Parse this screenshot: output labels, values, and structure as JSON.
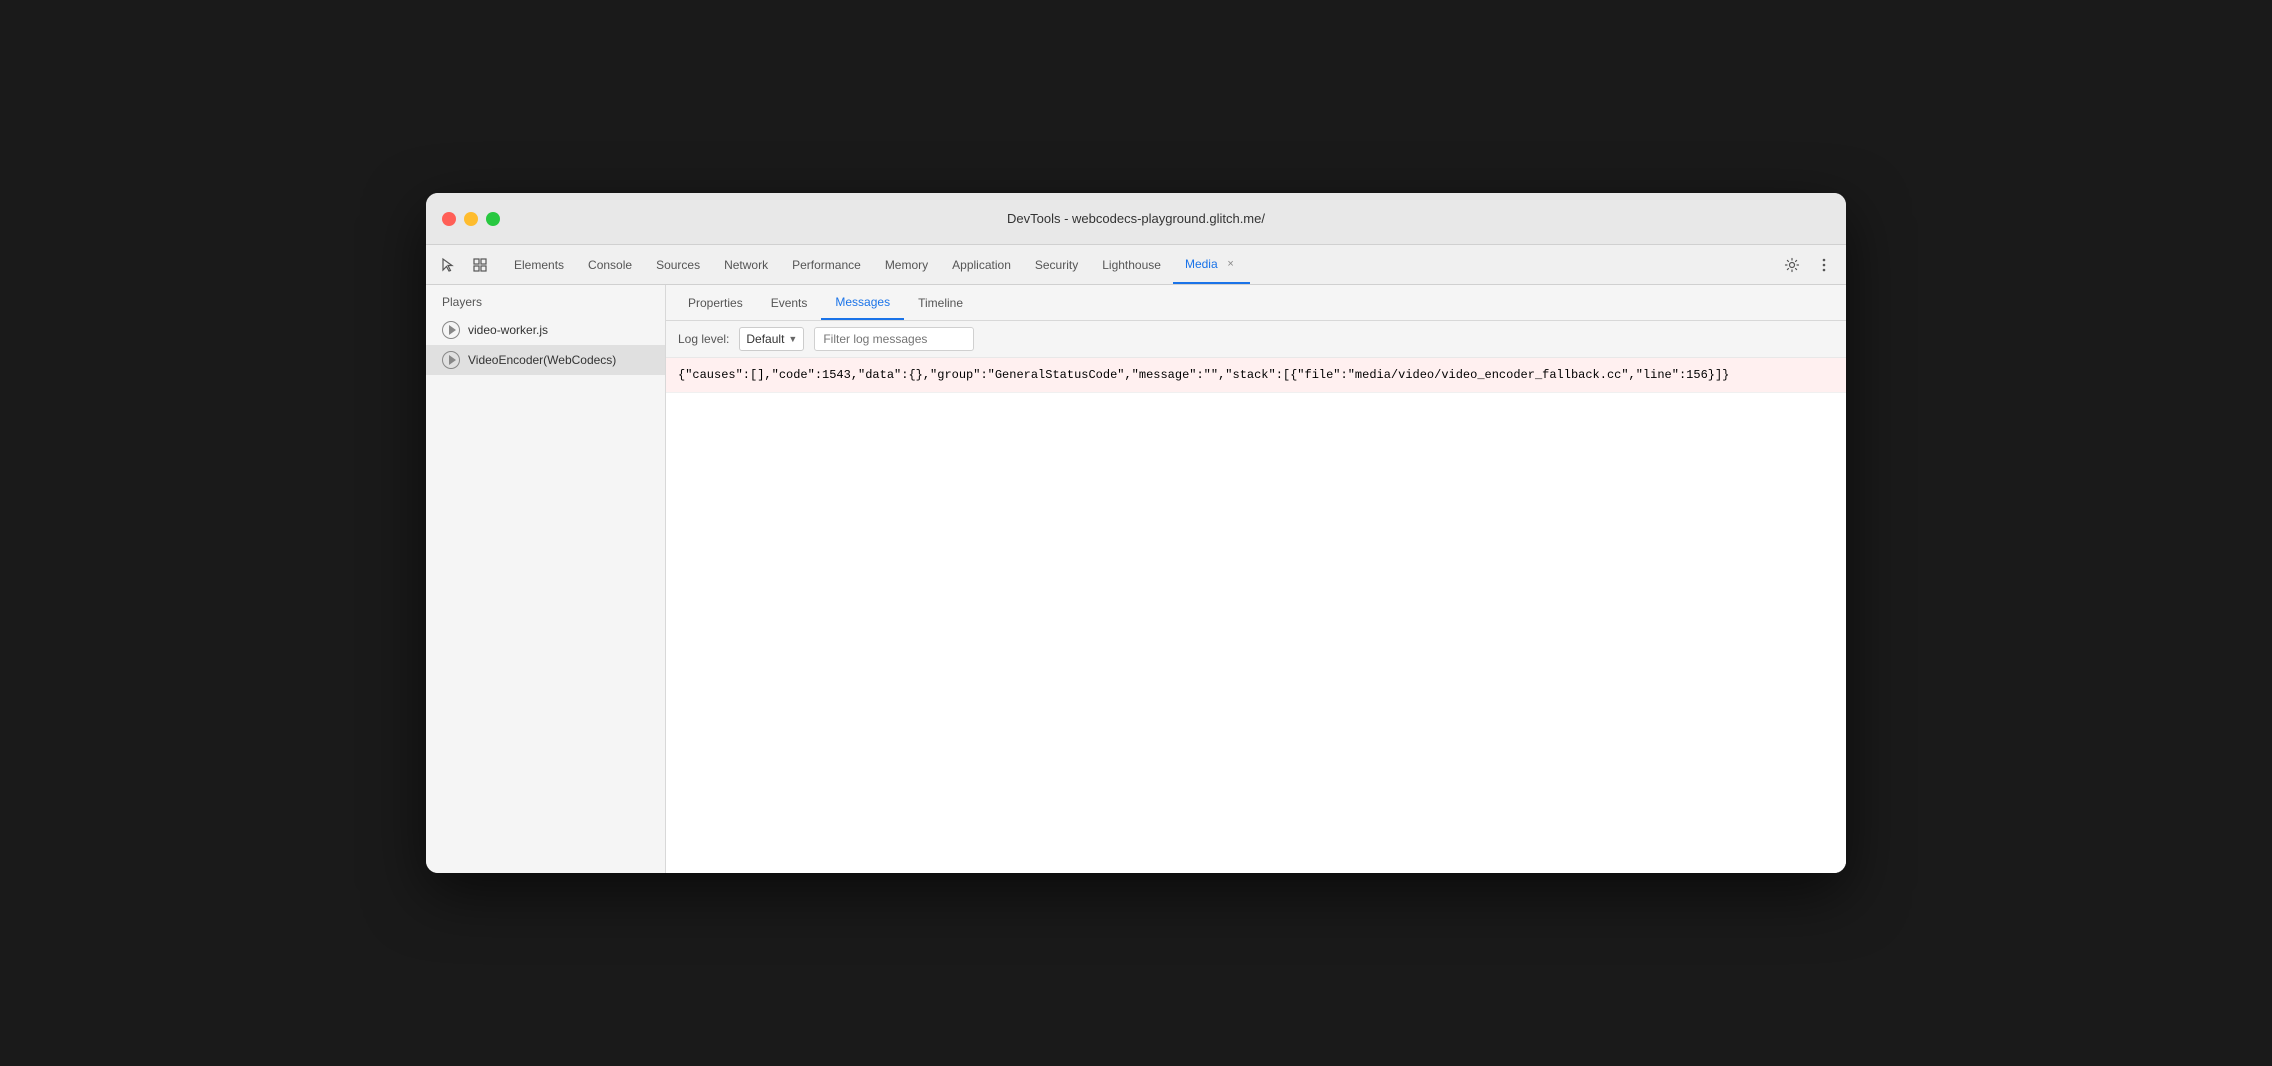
{
  "window": {
    "title": "DevTools - webcodecs-playground.glitch.me/"
  },
  "traffic_lights": {
    "close_label": "close",
    "minimize_label": "minimize",
    "maximize_label": "maximize"
  },
  "toolbar": {
    "cursor_icon": "⬚",
    "layers_icon": "▣",
    "settings_icon": "⚙",
    "more_icon": "⋮"
  },
  "tabs": [
    {
      "id": "elements",
      "label": "Elements",
      "active": false,
      "closeable": false
    },
    {
      "id": "console",
      "label": "Console",
      "active": false,
      "closeable": false
    },
    {
      "id": "sources",
      "label": "Sources",
      "active": false,
      "closeable": false
    },
    {
      "id": "network",
      "label": "Network",
      "active": false,
      "closeable": false
    },
    {
      "id": "performance",
      "label": "Performance",
      "active": false,
      "closeable": false
    },
    {
      "id": "memory",
      "label": "Memory",
      "active": false,
      "closeable": false
    },
    {
      "id": "application",
      "label": "Application",
      "active": false,
      "closeable": false
    },
    {
      "id": "security",
      "label": "Security",
      "active": false,
      "closeable": false
    },
    {
      "id": "lighthouse",
      "label": "Lighthouse",
      "active": false,
      "closeable": false
    },
    {
      "id": "media",
      "label": "Media",
      "active": true,
      "closeable": true
    }
  ],
  "sidebar": {
    "header": "Players",
    "players": [
      {
        "id": "video-worker",
        "label": "video-worker.js",
        "active": false
      },
      {
        "id": "video-encoder",
        "label": "VideoEncoder(WebCodecs)",
        "active": true
      }
    ]
  },
  "sub_tabs": [
    {
      "id": "properties",
      "label": "Properties",
      "active": false
    },
    {
      "id": "events",
      "label": "Events",
      "active": false
    },
    {
      "id": "messages",
      "label": "Messages",
      "active": true
    },
    {
      "id": "timeline",
      "label": "Timeline",
      "active": false
    }
  ],
  "messages_toolbar": {
    "log_level_label": "Log level:",
    "log_level_value": "Default",
    "filter_placeholder": "Filter log messages"
  },
  "messages": [
    {
      "id": "msg-1",
      "type": "error",
      "text": "{\"causes\":[],\"code\":1543,\"data\":{},\"group\":\"GeneralStatusCode\",\"message\":\"\",\"stack\":[{\"file\":\"media/video/video_encoder_fallback.cc\",\"line\":156}]}"
    }
  ]
}
